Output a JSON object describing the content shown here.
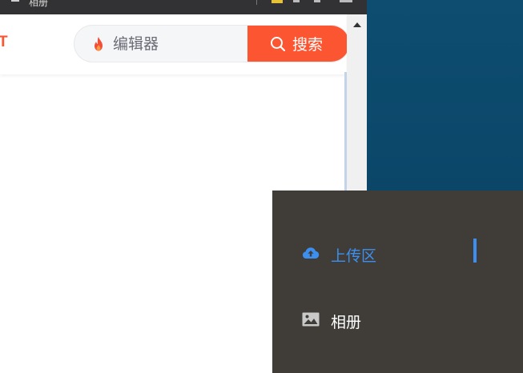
{
  "window": {
    "title_fragment": "相册"
  },
  "header": {
    "logo_fragment": "T",
    "search": {
      "placeholder": "编辑器",
      "hot_icon": "flame-icon",
      "button_label": "搜索",
      "button_icon": "search-icon"
    }
  },
  "side_menu": {
    "items": [
      {
        "label": "上传区",
        "icon": "cloud-upload-icon",
        "active": true
      },
      {
        "label": "相册",
        "icon": "image-icon",
        "active": false
      }
    ]
  },
  "colors": {
    "brand": "#fc5531",
    "active": "#3d8fef",
    "panel_bg": "#403d39",
    "desktop_bg": "#0b4a6b"
  }
}
